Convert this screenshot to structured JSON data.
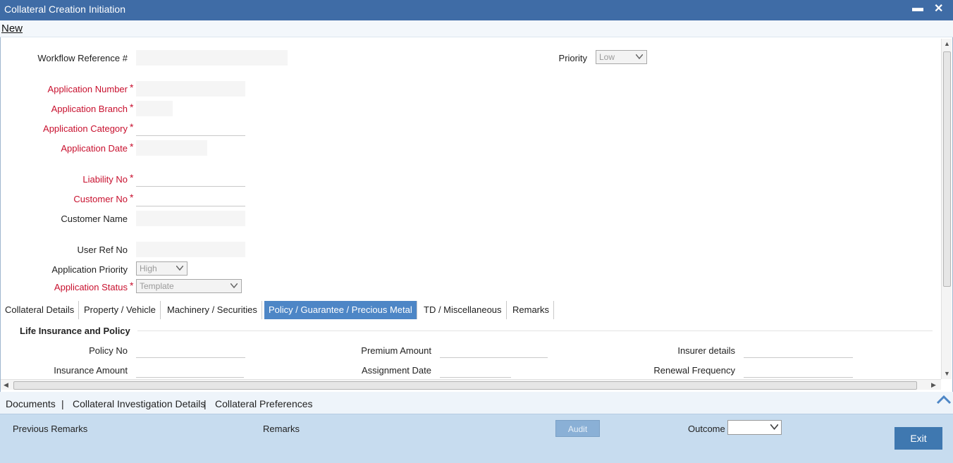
{
  "window": {
    "title": "Collateral Creation Initiation",
    "minimize_glyph": "▬",
    "close_glyph": "✕"
  },
  "menu": {
    "new_label": "New"
  },
  "header_fields": {
    "workflow_ref": {
      "label": "Workflow Reference #",
      "value": ""
    },
    "priority": {
      "label": "Priority",
      "value": "Low"
    }
  },
  "app_fields": {
    "application_number": {
      "label": "Application Number",
      "value": ""
    },
    "application_branch": {
      "label": "Application Branch",
      "value": ""
    },
    "application_category": {
      "label": "Application Category",
      "value": ""
    },
    "application_date": {
      "label": "Application Date",
      "value": ""
    },
    "liability_no": {
      "label": "Liability No",
      "value": ""
    },
    "customer_no": {
      "label": "Customer No",
      "value": ""
    },
    "customer_name": {
      "label": "Customer Name",
      "value": ""
    },
    "user_ref_no": {
      "label": "User Ref No",
      "value": ""
    },
    "application_priority": {
      "label": "Application Priority",
      "value": "High"
    },
    "application_status": {
      "label": "Application Status",
      "value": "Template"
    }
  },
  "required_marker": "*",
  "tabs": [
    {
      "label": "Collateral Details"
    },
    {
      "label": "Property / Vehicle"
    },
    {
      "label": "Machinery / Securities"
    },
    {
      "label": "Policy / Guarantee / Precious Metal"
    },
    {
      "label": "TD / Miscellaneous"
    },
    {
      "label": "Remarks"
    }
  ],
  "active_tab": "Policy / Guarantee / Precious Metal",
  "section": {
    "title": "Life Insurance and Policy",
    "policy_no": "Policy No",
    "insurance_amount": "Insurance Amount",
    "premium_amount": "Premium Amount",
    "assignment_date": "Assignment Date",
    "insurer_details": "Insurer details",
    "renewal_frequency": "Renewal Frequency"
  },
  "bottom_links": {
    "documents": "Documents",
    "investigation": "Collateral Investigation Details",
    "preferences": "Collateral Preferences",
    "separator": "|"
  },
  "footer": {
    "previous_remarks": "Previous Remarks",
    "remarks": "Remarks",
    "audit": "Audit",
    "outcome": "Outcome",
    "outcome_value": "",
    "exit": "Exit"
  },
  "colors": {
    "title_bar": "#3f6ca6",
    "active_tab": "#4d86c6",
    "required": "#c8102e",
    "footer": "#c7dcef",
    "exit_button": "#3f78b0"
  }
}
